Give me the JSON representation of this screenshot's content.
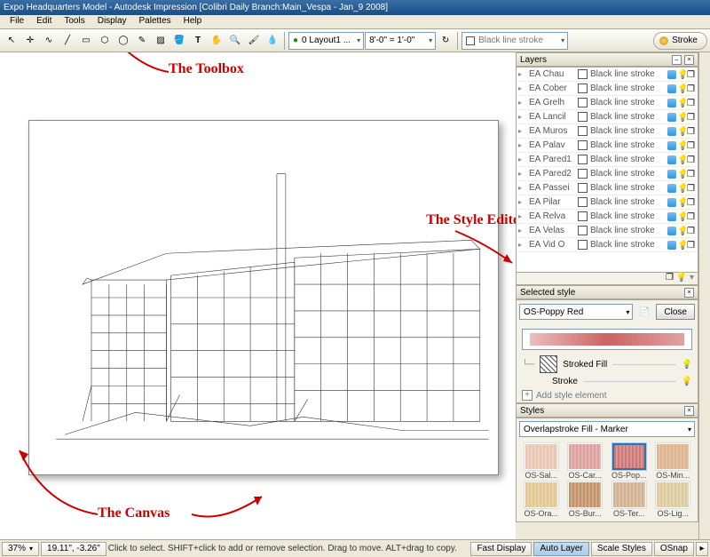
{
  "titlebar": {
    "text": "Expo Headquarters Model - Autodesk Impression [Colibri Daily Branch:Main_Vespa - Jan_9 2008]"
  },
  "menubar": {
    "items": [
      "File",
      "Edit",
      "Tools",
      "Display",
      "Palettes",
      "Help"
    ]
  },
  "toolbar": {
    "layout_label": "0  Layout1 ...",
    "scale_label": "8'-0\" = 1'-0\"",
    "stroke_label": "Black line stroke",
    "stroke_btn": "Stroke",
    "tool_icons": [
      "arrow",
      "crosshair",
      "curve",
      "line",
      "rect",
      "hex",
      "ellipse",
      "pen",
      "hatch",
      "bucket",
      "text",
      "hand",
      "zoom",
      "brush",
      "eyedrop"
    ]
  },
  "annotations": {
    "toolbox": "The Toolbox",
    "style_editor": "The Style Editor",
    "canvas": "The Canvas"
  },
  "layers": {
    "title": "Layers",
    "stroke_label": "Black line stroke",
    "items": [
      {
        "name": "EA Chau"
      },
      {
        "name": "EA Cober"
      },
      {
        "name": "EA Grelh"
      },
      {
        "name": "EA Lancil"
      },
      {
        "name": "EA Muros"
      },
      {
        "name": "EA Palav"
      },
      {
        "name": "EA Pared1"
      },
      {
        "name": "EA Pared2"
      },
      {
        "name": "EA Passei"
      },
      {
        "name": "EA Pilar"
      },
      {
        "name": "EA Relva"
      },
      {
        "name": "EA Velas"
      },
      {
        "name": "EA Vid O"
      }
    ]
  },
  "selected_style": {
    "title": "Selected style",
    "name": "OS-Poppy Red",
    "close": "Close",
    "stroked_fill": "Stroked Fill",
    "stroke": "Stroke",
    "add_element": "Add style element"
  },
  "styles": {
    "title": "Styles",
    "category": "Overlapstroke Fill - Marker",
    "swatches": [
      {
        "label": "OS-Sal...",
        "color": "#e8bca7"
      },
      {
        "label": "OS-Car...",
        "color": "#d98b8b"
      },
      {
        "label": "OS-Pop...",
        "color": "#c65858",
        "selected": true
      },
      {
        "label": "OS-Min...",
        "color": "#d9a477"
      },
      {
        "label": "OS-Ora...",
        "color": "#e0bc80"
      },
      {
        "label": "OS-Bur...",
        "color": "#b87a4a"
      },
      {
        "label": "OS-Ter...",
        "color": "#caa27a"
      },
      {
        "label": "OS-Lig...",
        "color": "#d9c28f"
      }
    ]
  },
  "statusbar": {
    "zoom": "37%",
    "coords": "19.11\", -3.26\"",
    "hint": "Click to select. SHIFT+click to add or remove selection. Drag to move. ALT+drag to copy.",
    "buttons": {
      "fast": "Fast Display",
      "auto": "Auto Layer",
      "scale": "Scale Styles",
      "osnap": "OSnap"
    }
  },
  "icons": {
    "arrow": "↖",
    "crosshair": "✛",
    "curve": "∿",
    "line": "╱",
    "rect": "▭",
    "hex": "⬡",
    "ellipse": "◯",
    "pen": "✎",
    "hatch": "▨",
    "bucket": "🪣",
    "text": "T",
    "hand": "✋",
    "zoom": "🔍",
    "brush": "🖌",
    "eyedrop": "💧",
    "eye": "👁",
    "bulb": "💡",
    "dup": "❐",
    "green": "●",
    "copy": "📄"
  }
}
